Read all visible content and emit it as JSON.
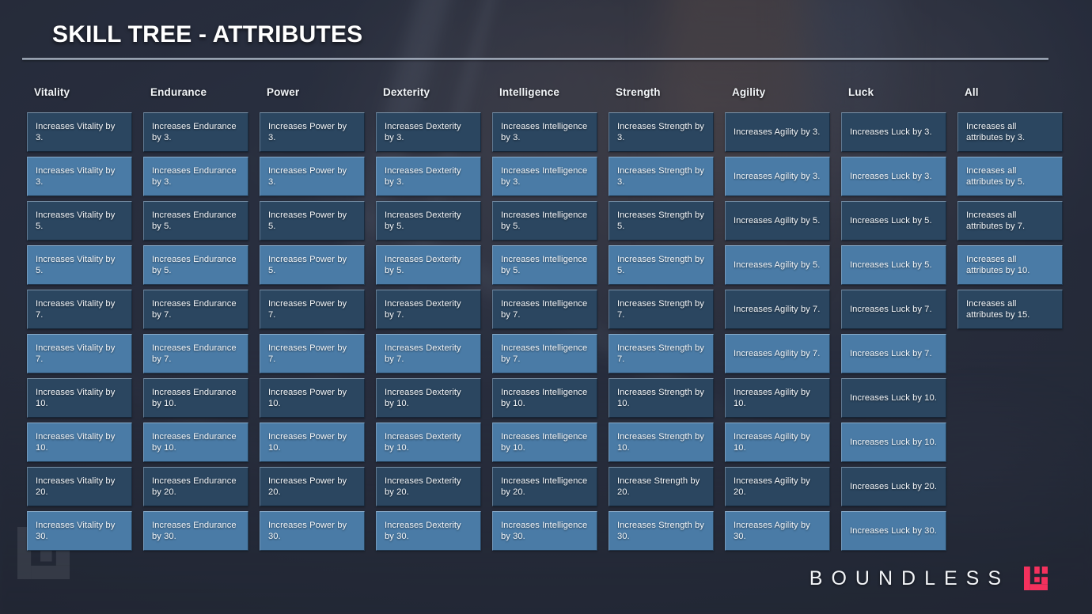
{
  "header": {
    "title": "SKILL TREE - ATTRIBUTES"
  },
  "colors": {
    "background": "#282d3d",
    "card_dark": "#2b4660",
    "card_light": "#4a7ba6",
    "text": "#f4f7fa",
    "brand_accent": "#f4315d"
  },
  "footer": {
    "wordmark": "BOUNDLESS",
    "logo_icon": "boundless-logo-icon"
  },
  "columns": [
    {
      "header": "Vitality",
      "cards": [
        "Increases Vitality by 3.",
        "Increases Vitality by 3.",
        "Increases Vitality by 5.",
        "Increases Vitality by 5.",
        "Increases Vitality by 7.",
        "Increases Vitality by 7.",
        "Increases Vitality by 10.",
        "Increases Vitality by 10.",
        "Increases Vitality by 20.",
        "Increases Vitality by 30."
      ]
    },
    {
      "header": "Endurance",
      "cards": [
        "Increases Endurance by 3.",
        "Increases Endurance by 3.",
        "Increases Endurance by 5.",
        "Increases Endurance by 5.",
        "Increases Endurance by 7.",
        "Increases Endurance by 7.",
        "Increases Endurance by 10.",
        "Increases Endurance by 10.",
        "Increases Endurance by 20.",
        "Increases Endurance by 30."
      ]
    },
    {
      "header": "Power",
      "cards": [
        "Increases Power by 3.",
        "Increases Power by 3.",
        "Increases Power by 5.",
        "Increases Power by 5.",
        "Increases Power by 7.",
        "Increases Power by 7.",
        "Increases Power by 10.",
        "Increases Power by 10.",
        "Increases Power by 20.",
        "Increases Power by 30."
      ]
    },
    {
      "header": "Dexterity",
      "cards": [
        "Increases Dexterity by 3.",
        "Increases Dexterity by 3.",
        "Increases Dexterity by 5.",
        "Increases Dexterity by 5.",
        "Increases Dexterity by 7.",
        "Increases Dexterity by 7.",
        "Increases Dexterity by 10.",
        "Increases Dexterity by 10.",
        "Increases Dexterity by 20.",
        "Increases Dexterity by 30."
      ]
    },
    {
      "header": "Intelligence",
      "cards": [
        "Increases Intelligence by 3.",
        "Increases Intelligence by 3.",
        "Increases Intelligence by 5.",
        "Increases Intelligence by 5.",
        "Increases Intelligence by 7.",
        "Increases Intelligence by 7.",
        "Increases Intelligence by 10.",
        "Increases Intelligence by 10.",
        "Increases Intelligence by 20.",
        "Increases Intelligence by 30."
      ]
    },
    {
      "header": "Strength",
      "cards": [
        "Increases Strength by 3.",
        "Increases Strength by 3.",
        "Increases Strength by 5.",
        "Increases Strength by 5.",
        "Increases Strength by 7.",
        "Increases Strength by 7.",
        "Increases Strength by 10.",
        "Increases Strength by 10.",
        "Increase Strength by 20.",
        "Increases Strength by 30."
      ]
    },
    {
      "header": "Agility",
      "cards": [
        "Increases Agility by 3.",
        "Increases Agility by 3.",
        "Increases Agility by 5.",
        "Increases Agility by 5.",
        "Increases Agility by 7.",
        "Increases Agility by 7.",
        "Increases Agility by 10.",
        "Increases Agility by 10.",
        "Increases Agility by 20.",
        "Increases Agility by 30."
      ]
    },
    {
      "header": "Luck",
      "cards": [
        "Increases Luck by 3.",
        "Increases Luck by 3.",
        "Increases Luck by 5.",
        "Increases Luck by 5.",
        "Increases Luck by 7.",
        "Increases Luck by 7.",
        "Increases Luck by 10.",
        "Increases Luck by 10.",
        "Increases Luck by 20.",
        "Increases Luck by 30."
      ]
    },
    {
      "header": "All",
      "cards": [
        "Increases all attributes by 3.",
        "Increases all attributes by 5.",
        "Increases all attributes by 7.",
        "Increases all attributes by 10.",
        "Increases all attributes by 15."
      ]
    }
  ]
}
